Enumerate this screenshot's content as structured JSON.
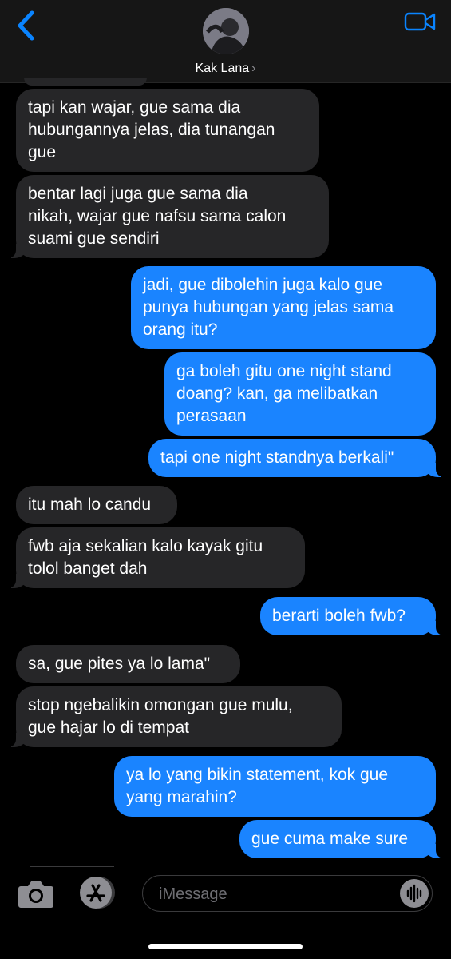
{
  "header": {
    "contact_name": "Kak Lana",
    "chevron": "›",
    "back_icon": "chevron-left-icon",
    "video_icon": "video-camera-icon"
  },
  "messages": [
    {
      "direction": "incoming",
      "text": "tapi kan wajar, gue sama dia\nhubungannya jelas, dia tunangan\ngue"
    },
    {
      "direction": "incoming",
      "text": "bentar lagi juga gue sama dia\nnikah, wajar gue nafsu sama calon\nsuami gue sendiri"
    },
    {
      "direction": "outgoing",
      "text": "jadi, gue dibolehin juga kalo gue\npunya hubungan yang jelas sama\norang itu?"
    },
    {
      "direction": "outgoing",
      "text": "ga boleh gitu one night stand\ndoang? kan, ga melibatkan\nperasaan"
    },
    {
      "direction": "outgoing",
      "text": "tapi one night standnya berkali\""
    },
    {
      "direction": "incoming",
      "text": "itu mah lo candu"
    },
    {
      "direction": "incoming",
      "text": "fwb aja sekalian kalo kayak gitu\ntolol banget dah"
    },
    {
      "direction": "outgoing",
      "text": "berarti boleh fwb?"
    },
    {
      "direction": "incoming",
      "text": "sa, gue pites ya lo lama\""
    },
    {
      "direction": "incoming",
      "text": "stop ngebalikin omongan gue mulu,\ngue hajar lo di tempat"
    },
    {
      "direction": "outgoing",
      "text": "ya lo yang bikin statement, kok gue\nyang marahin?"
    },
    {
      "direction": "outgoing",
      "text": "gue cuma make sure"
    }
  ],
  "composer": {
    "placeholder": "iMessage",
    "camera_icon": "camera-icon",
    "appstore_icon": "app-store-icon",
    "audio_icon": "audio-waveform-icon"
  },
  "colors": {
    "outgoing_bubble": "#1a84ff",
    "incoming_bubble": "#262628",
    "accent": "#0a84ff",
    "background": "#000000"
  }
}
